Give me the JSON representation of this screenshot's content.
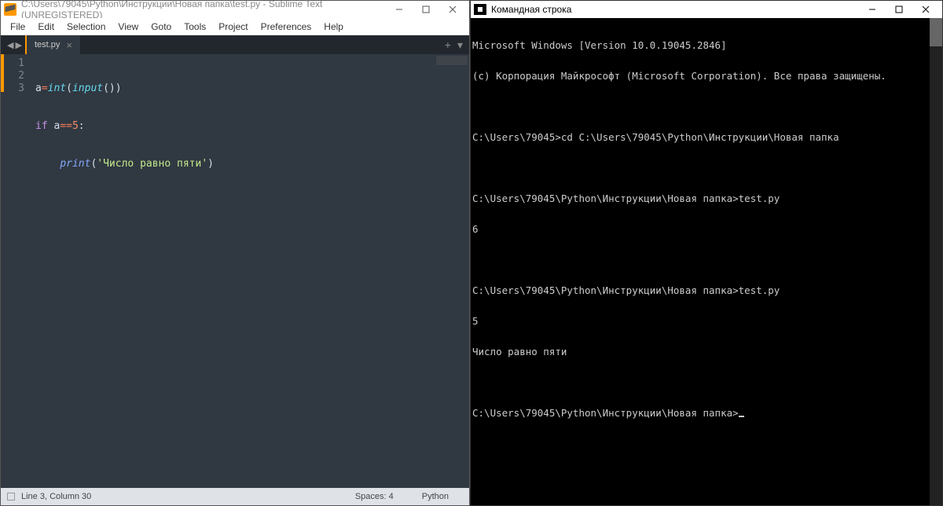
{
  "sublime": {
    "title": "C:\\Users\\79045\\Python\\Инструкции\\Новая папка\\test.py - Sublime Text (UNREGISTERED)",
    "menu": [
      "File",
      "Edit",
      "Selection",
      "View",
      "Goto",
      "Tools",
      "Project",
      "Preferences",
      "Help"
    ],
    "tab_name": "test.py",
    "lines": [
      "1",
      "2",
      "3"
    ],
    "code": {
      "l1_var": "a",
      "l1_eq": "=",
      "l1_int": "int",
      "l1_p1": "(",
      "l1_input": "input",
      "l1_p2": "())",
      "l2_if": "if",
      "l2_sp": " ",
      "l2_a": "a",
      "l2_eqeq": "==",
      "l2_5": "5",
      "l2_colon": ":",
      "l3_indent": "    ",
      "l3_print": "print",
      "l3_p1": "(",
      "l3_str": "'Число равно пяти'",
      "l3_p2": ")"
    },
    "status": {
      "cursor": "Line 3, Column 30",
      "spaces": "Spaces: 4",
      "lang": "Python"
    }
  },
  "cmd": {
    "title": "Командная строка",
    "lines": [
      "Microsoft Windows [Version 10.0.19045.2846]",
      "(c) Корпорация Майкрософт (Microsoft Corporation). Все права защищены.",
      "",
      "C:\\Users\\79045>cd C:\\Users\\79045\\Python\\Инструкции\\Новая папка",
      "",
      "C:\\Users\\79045\\Python\\Инструкции\\Новая папка>test.py",
      "6",
      "",
      "C:\\Users\\79045\\Python\\Инструкции\\Новая папка>test.py",
      "5",
      "Число равно пяти",
      "",
      "C:\\Users\\79045\\Python\\Инструкции\\Новая папка>"
    ]
  }
}
